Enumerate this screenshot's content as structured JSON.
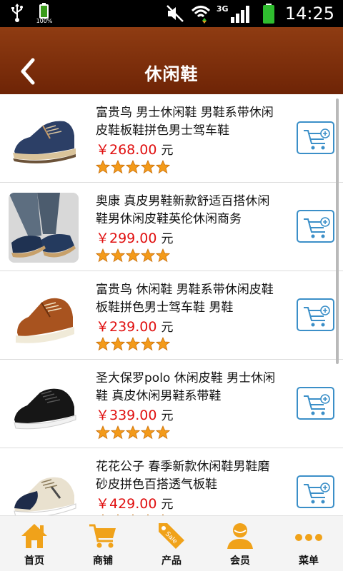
{
  "status_bar": {
    "battery_percent": "100%",
    "network": "3G",
    "time": "14:25"
  },
  "header": {
    "title": "休闲鞋"
  },
  "products": [
    {
      "name": "富贵鸟 男士休闲鞋 男鞋系带休闲皮鞋板鞋拼色男士驾车鞋",
      "price": "￥268.00",
      "unit": "元",
      "rating": 5
    },
    {
      "name": "奥康 真皮男鞋新款舒适百搭休闲鞋男休闲皮鞋英伦休闲商务",
      "price": "￥299.00",
      "unit": "元",
      "rating": 5
    },
    {
      "name": "富贵鸟 休闲鞋 男鞋系带休闲皮鞋板鞋拼色男士驾车鞋 男鞋",
      "price": "￥239.00",
      "unit": "元",
      "rating": 5
    },
    {
      "name": "圣大保罗polo 休闲皮鞋 男士休闲鞋 真皮休闲男鞋系带鞋",
      "price": "￥339.00",
      "unit": "元",
      "rating": 5
    },
    {
      "name": "花花公子 春季新款休闲鞋男鞋磨砂皮拼色百搭透气板鞋",
      "price": "￥429.00",
      "unit": "元",
      "rating": 5
    }
  ],
  "nav": [
    {
      "label": "首页",
      "icon": "home-icon"
    },
    {
      "label": "商铺",
      "icon": "cart-icon"
    },
    {
      "label": "产品",
      "icon": "sale-tag-icon"
    },
    {
      "label": "会员",
      "icon": "user-icon"
    },
    {
      "label": "菜单",
      "icon": "more-icon"
    }
  ],
  "colors": {
    "header": "#7a2c0a",
    "price": "#e01010",
    "accent": "#3b8fc8",
    "star": "#f39a1a",
    "nav_icon": "#f0a21a"
  }
}
